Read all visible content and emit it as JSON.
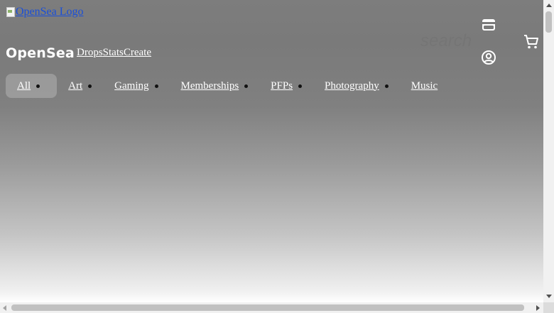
{
  "header": {
    "logo_alt": "OpenSea Logo",
    "wordmark": "OpenSea",
    "nav": [
      "Drops",
      "Stats",
      "Create"
    ],
    "search_label": "search",
    "icons": {
      "wallet": "wallet-icon",
      "account": "account-circle-icon",
      "cart": "shopping-cart-icon"
    }
  },
  "categories": {
    "active": "All",
    "items": [
      "All",
      "Art",
      "Gaming",
      "Memberships",
      "PFPs",
      "Photography",
      "Music"
    ]
  },
  "colors": {
    "link_blue": "#1a4fd8",
    "overlay_text": "#ffffff",
    "scrollbar_track": "#f1f1f1",
    "scrollbar_thumb": "#c1c1c1"
  }
}
